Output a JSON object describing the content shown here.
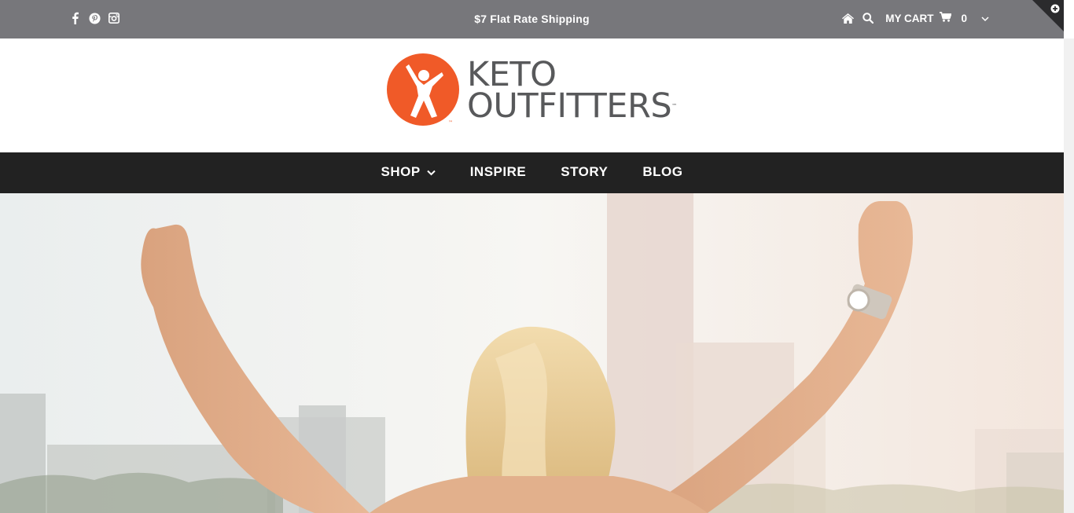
{
  "topbar": {
    "shipping_text": "$7 Flat Rate Shipping",
    "social_icons": [
      "facebook-icon",
      "pinterest-icon",
      "instagram-icon"
    ],
    "cart_label": "MY CART",
    "cart_count": "0"
  },
  "logo": {
    "line1": "KETO",
    "line2": "OUTFITTERS",
    "tm": "™"
  },
  "nav": {
    "items": [
      {
        "label": "SHOP"
      },
      {
        "label": "INSPIRE"
      },
      {
        "label": "STORY"
      },
      {
        "label": "BLOG"
      }
    ]
  },
  "colors": {
    "topbar_bg": "#77777b",
    "nav_bg": "#222222",
    "brand_orange": "#f05a28",
    "logo_gray": "#58595b"
  }
}
